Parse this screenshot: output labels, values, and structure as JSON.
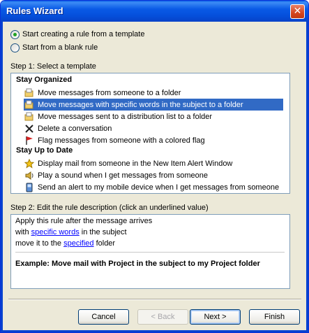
{
  "window": {
    "title": "Rules Wizard",
    "close_glyph": "✕"
  },
  "start_options": [
    {
      "label": "Start creating a rule from a template",
      "checked": true
    },
    {
      "label": "Start from a blank rule",
      "checked": false
    }
  ],
  "step1": {
    "label": "Step 1: Select a template",
    "groups": [
      {
        "header": "Stay Organized",
        "items": [
          {
            "icon": "move-folder-icon",
            "label": "Move messages from someone to a folder",
            "selected": false
          },
          {
            "icon": "move-folder-icon",
            "label": "Move messages with specific words in the subject to a folder",
            "selected": true
          },
          {
            "icon": "move-folder-icon",
            "label": "Move messages sent to a distribution list to a folder",
            "selected": false
          },
          {
            "icon": "delete-x-icon",
            "label": "Delete a conversation",
            "selected": false
          },
          {
            "icon": "flag-icon",
            "label": "Flag messages from someone with a colored flag",
            "selected": false
          }
        ]
      },
      {
        "header": "Stay Up to Date",
        "items": [
          {
            "icon": "alert-star-icon",
            "label": "Display mail from someone in the New Item Alert Window",
            "selected": false
          },
          {
            "icon": "sound-icon",
            "label": "Play a sound when I get messages from someone",
            "selected": false
          },
          {
            "icon": "mobile-device-icon",
            "label": "Send an alert to my mobile device when I get messages from someone",
            "selected": false
          }
        ]
      }
    ]
  },
  "step2": {
    "label": "Step 2: Edit the rule description (click an underlined value)",
    "line1": "Apply this rule after the message arrives",
    "line2_prefix": "with ",
    "line2_link": "specific words",
    "line2_suffix": " in the subject",
    "line3_prefix": "move it to the ",
    "line3_link": "specified",
    "line3_suffix": " folder",
    "example": "Example: Move mail with Project in the subject to my Project folder"
  },
  "buttons": {
    "cancel": "Cancel",
    "back": "< Back",
    "next": "Next >",
    "finish": "Finish"
  }
}
